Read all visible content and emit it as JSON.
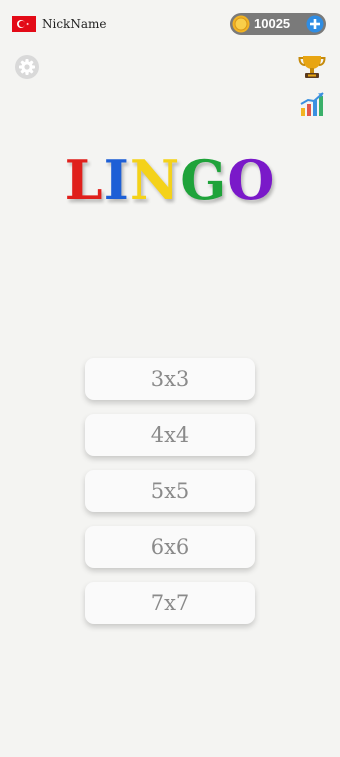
{
  "header": {
    "nickname": "NickName",
    "flag_icon": "turkey-flag-icon",
    "coins": "10025"
  },
  "icons": {
    "settings": "gear-icon",
    "leaderboard": "trophy-icon",
    "statistics": "bar-chart-icon",
    "add_coins": "plus-icon",
    "coin": "coin-icon"
  },
  "title": {
    "letters": [
      {
        "char": "L",
        "color": "#e0201c"
      },
      {
        "char": "I",
        "color": "#1d5fd6"
      },
      {
        "char": "N",
        "color": "#f4d21a"
      },
      {
        "char": "G",
        "color": "#1fa33a"
      },
      {
        "char": "O",
        "color": "#7a19c9"
      }
    ]
  },
  "menu": {
    "modes": [
      "3x3",
      "4x4",
      "5x5",
      "6x6",
      "7x7"
    ]
  }
}
